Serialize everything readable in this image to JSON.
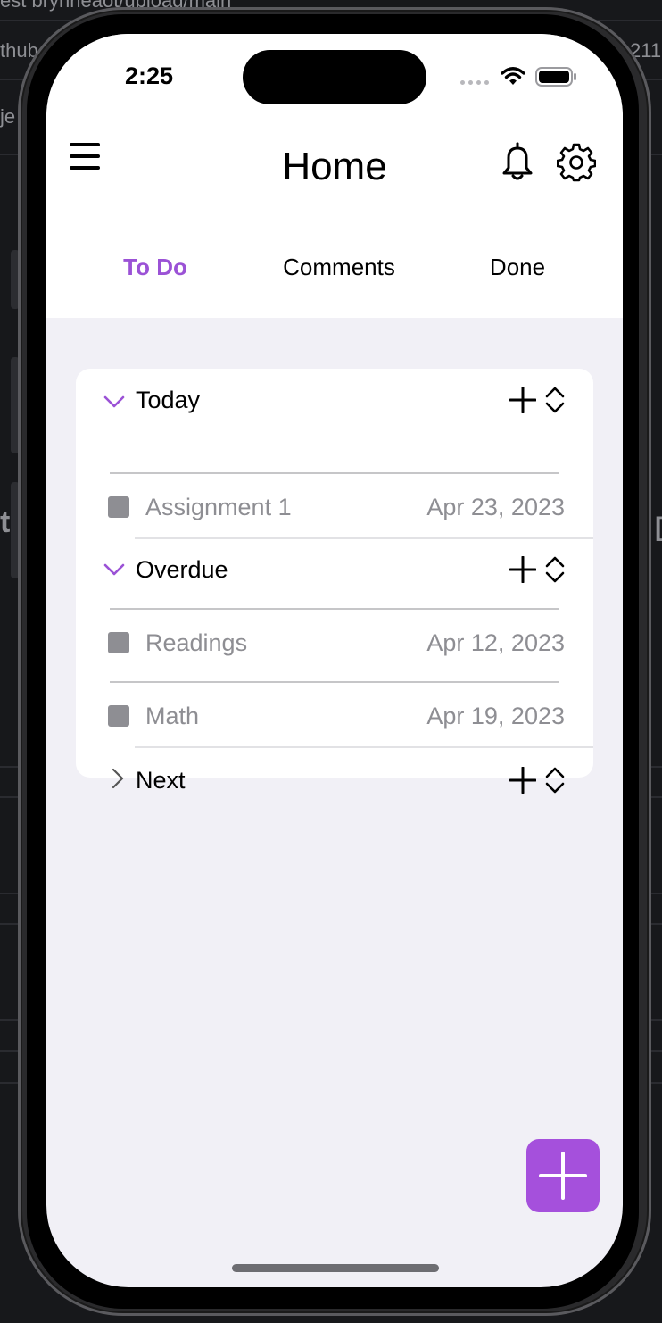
{
  "background": {
    "fragments": [
      "est  brynneaot/upload/main",
      "thub",
      "je",
      "t",
      "211",
      "["
    ]
  },
  "status_bar": {
    "time": "2:25",
    "wifi_icon": "wifi-icon",
    "battery_icon": "battery-icon"
  },
  "header": {
    "title": "Home",
    "menu_icon": "hamburger-menu-icon",
    "notifications_icon": "bell-icon",
    "settings_icon": "gear-icon"
  },
  "tabs": [
    {
      "label": "To Do",
      "active": true
    },
    {
      "label": "Comments",
      "active": false
    },
    {
      "label": "Done",
      "active": false
    }
  ],
  "sections": [
    {
      "title": "Today",
      "expanded": true,
      "tasks": [
        {
          "label": "Assignment 1",
          "date": "Apr 23, 2023",
          "checked": false
        }
      ]
    },
    {
      "title": "Overdue",
      "expanded": true,
      "tasks": [
        {
          "label": "Readings",
          "date": "Apr 12, 2023",
          "checked": false
        },
        {
          "label": "Math",
          "date": "Apr 19, 2023",
          "checked": false
        }
      ]
    },
    {
      "title": "Next",
      "expanded": false,
      "tasks": []
    }
  ],
  "fab": {
    "icon": "plus-icon"
  },
  "colors": {
    "accent": "#9b52d6",
    "fab": "#a550dc",
    "content_bg": "#f1f0f6",
    "secondary_text": "#8e8e93"
  }
}
